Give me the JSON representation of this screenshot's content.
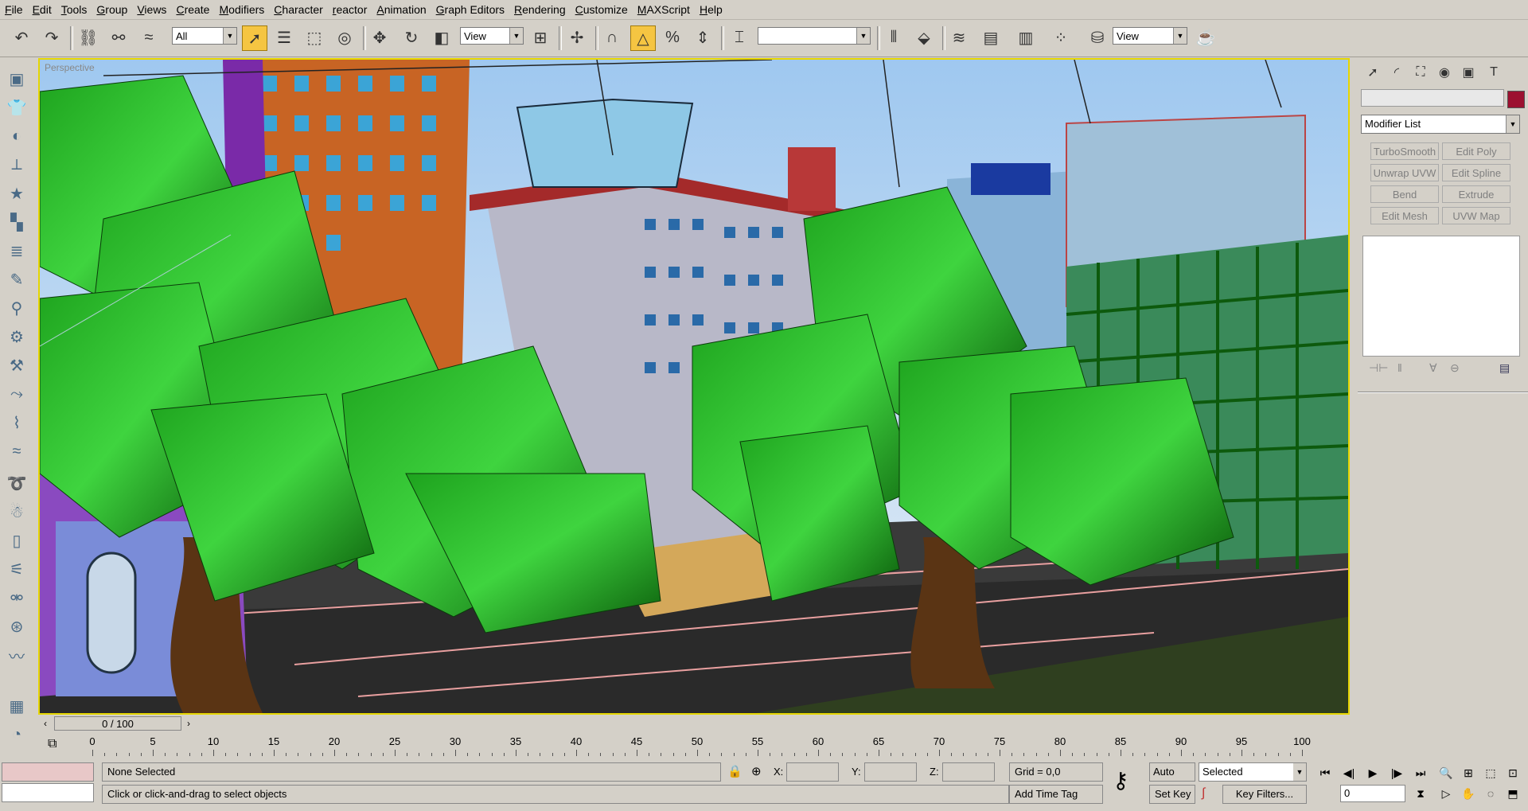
{
  "menu": [
    "File",
    "Edit",
    "Tools",
    "Group",
    "Views",
    "Create",
    "Modifiers",
    "Character",
    "reactor",
    "Animation",
    "Graph Editors",
    "Rendering",
    "Customize",
    "MAXScript",
    "Help"
  ],
  "toolbar": {
    "selection_filter": "All",
    "ref_coord": "View",
    "named_selection": "",
    "render_view": "View"
  },
  "viewport": {
    "label": "Perspective"
  },
  "command_panel": {
    "modifier_list": "Modifier List",
    "modifiers": [
      "TurboSmooth",
      "Edit Poly",
      "Unwrap UVW",
      "Edit Spline",
      "Bend",
      "Extrude",
      "Edit Mesh",
      "UVW Map"
    ],
    "object_color": "#9c1030"
  },
  "time_slider": {
    "frame_display": "0 / 100"
  },
  "track_bar": {
    "ticks": [
      "0",
      "5",
      "10",
      "15",
      "20",
      "25",
      "30",
      "35",
      "40",
      "45",
      "50",
      "55",
      "60",
      "65",
      "70",
      "75",
      "80",
      "85",
      "90",
      "95",
      "100"
    ]
  },
  "status": {
    "selection": "None Selected",
    "prompt": "Click or click-and-drag to select objects",
    "x_label": "X:",
    "y_label": "Y:",
    "z_label": "Z:",
    "x_value": "",
    "y_value": "",
    "z_value": "",
    "grid": "Grid = 0,0",
    "add_time_tag": "Add Time Tag",
    "auto_key": "Auto Key",
    "set_key": "Set Key",
    "key_mode": "Selected",
    "key_filters": "Key Filters...",
    "current_frame": "0"
  }
}
